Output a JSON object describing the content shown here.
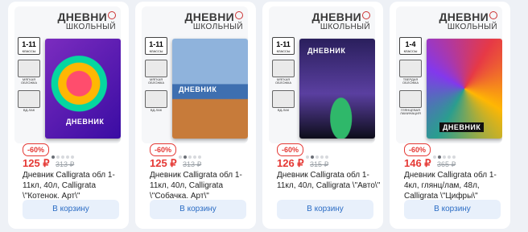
{
  "products": [
    {
      "brand_line1": "ДНЕВНИ",
      "brand_line2": "ШКОЛЬНЫЙ",
      "grade": "1-11",
      "grade_sub": "КЛАССЫ",
      "feature1": "МЯГКАЯ ОБЛОЖКА",
      "feature2": "ВД-ЛАК",
      "book_title": "ДНЕВНИК",
      "discount": "-60%",
      "price": "125 ₽",
      "old_price": "313 ₽",
      "name": "Дневник Calligrata обл 1-11кл, 40л, Calligrata \\\"Котенок. Арт\\\"",
      "button": "В корзину",
      "cover_colors": [
        "#7b2cbf",
        "#ff4d6d",
        "#ffb703",
        "#06d6a0"
      ]
    },
    {
      "brand_line1": "ДНЕВНИ",
      "brand_line2": "ШКОЛЬНЫЙ",
      "grade": "1-11",
      "grade_sub": "КЛАССЫ",
      "feature1": "МЯГКАЯ ОБЛОЖКА",
      "feature2": "ВД-ЛАК",
      "book_title": "ДНЕВНИК",
      "discount": "-60%",
      "price": "125 ₽",
      "old_price": "313 ₽",
      "name": "Дневник Calligrata обл 1-11кл, 40л, Calligrata \\\"Собачка. Арт\\\"",
      "button": "В корзину",
      "cover_colors": [
        "#3e6fb0",
        "#8fb3dc",
        "#c77b3a",
        "#f1d9b5"
      ]
    },
    {
      "brand_line1": "ДНЕВНИ",
      "brand_line2": "ШКОЛЬНЫЙ",
      "grade": "1-11",
      "grade_sub": "КЛАССЫ",
      "feature1": "МЯГКАЯ ОБЛОЖКА",
      "feature2": "ВД-ЛАК",
      "book_title": "ДНЕВНИК",
      "discount": "-60%",
      "price": "126 ₽",
      "old_price": "315 ₽",
      "name": "Дневник Calligrata обл 1-11кл, 40л, Calligrata \\\"Авто\\\"",
      "button": "В корзину",
      "cover_colors": [
        "#2a1f5c",
        "#5a3fa0",
        "#2fb86a",
        "#0d0d1a"
      ]
    },
    {
      "brand_line1": "ДНЕВНИ",
      "brand_line2": "ШКОЛЬНЫЙ",
      "grade": "1-4",
      "grade_sub": "КЛАССЫ",
      "feature1": "ТВЕРДАЯ ОБЛОЖКА",
      "feature2": "ГЛЯНЦЕВАЯ ЛАМИНАЦИЯ",
      "book_title": "ДНЕВНИК",
      "discount": "-60%",
      "price": "146 ₽",
      "old_price": "365 ₽",
      "name": "Дневник Calligrata обл 1-4кл, глянц/лам, 48л, Calligrata \\\"Цифры\\\"",
      "button": "В корзину",
      "cover_colors": [
        "#e63946",
        "#ffb703",
        "#2a9d8f",
        "#8338ec"
      ]
    }
  ],
  "colors": {
    "price": "#e53935",
    "button_bg": "#e8f0fb",
    "button_text": "#2b6cc4",
    "page_bg": "#eef1f6"
  }
}
